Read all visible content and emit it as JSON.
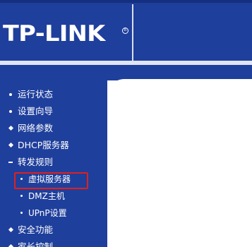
{
  "header": {
    "logo_text": "TP-LINK",
    "logo_reg_mark": "R"
  },
  "sidebar": {
    "items": [
      {
        "label": "运行状态",
        "level": 1,
        "marker": "dot"
      },
      {
        "label": "设置向导",
        "level": 1,
        "marker": "dot"
      },
      {
        "label": "网络参数",
        "level": 1,
        "marker": "plus"
      },
      {
        "label": "DHCP服务器",
        "level": 1,
        "marker": "plus"
      },
      {
        "label": "转发规则",
        "level": 1,
        "marker": "minus"
      },
      {
        "label": "虚拟服务器",
        "level": 2,
        "marker": "dot",
        "highlighted": true
      },
      {
        "label": "DMZ主机",
        "level": 2,
        "marker": "dot"
      },
      {
        "label": "UPnP设置",
        "level": 2,
        "marker": "dot"
      },
      {
        "label": "安全功能",
        "level": 1,
        "marker": "plus"
      },
      {
        "label": "家长控制",
        "level": 1,
        "marker": "plus"
      }
    ]
  },
  "colors": {
    "brand_blue": "#1f3f9c",
    "highlight_red": "#e0201e",
    "text": "#ffffff"
  }
}
